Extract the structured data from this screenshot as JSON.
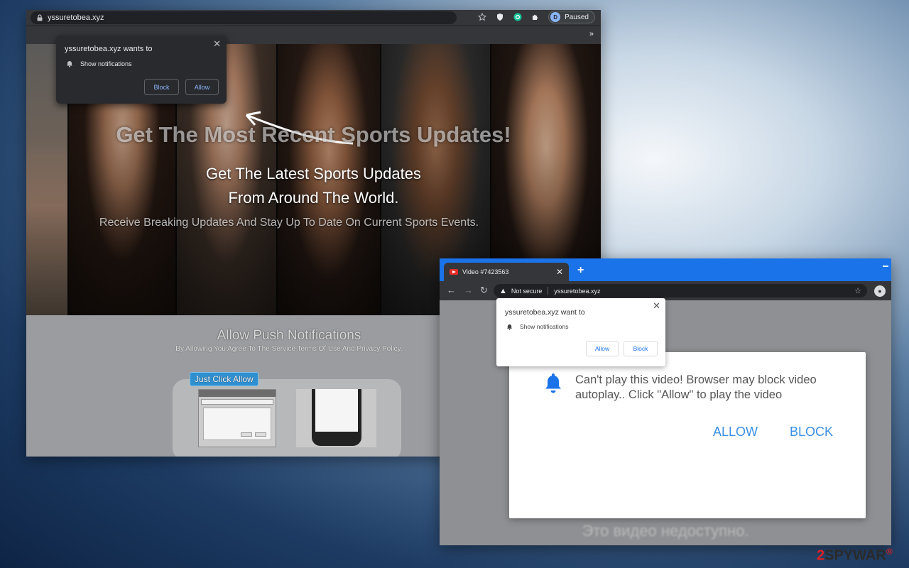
{
  "browser1": {
    "url": "yssuretobea.xyz",
    "profile": {
      "initial": "D",
      "label": "Paused"
    },
    "bookmarks_more": "»",
    "notification": {
      "title": "yssuretobea.xyz wants to",
      "item": "Show notifications",
      "block": "Block",
      "allow": "Allow",
      "close": "✕"
    },
    "hero": {
      "headline": "Get The Most Recent Sports Updates!",
      "subline1": "Get The Latest Sports Updates",
      "subline2": "From Around The World.",
      "body": "Receive Breaking Updates And Stay Up To Date On Current Sports Events."
    },
    "lower": {
      "title": "Allow Push Notifications",
      "subtitle": "By Allowing You Agree To The Service Terms Of Use And Privacy Policy.",
      "button": "Just Click Allow"
    }
  },
  "browser2": {
    "tab_title": "Video #7423563",
    "tab_close": "✕",
    "new_tab": "+",
    "not_secure": "Not secure",
    "url": "yssuretobea.xyz",
    "notification": {
      "title": "yssuretobea.xyz want to",
      "item": "Show notifications",
      "allow": "Allow",
      "block": "Block",
      "close": "✕"
    },
    "dialog": {
      "message": "Can't play this video! Browser may block video autoplay.. Click \"Allow\" to play the video",
      "allow": "ALLOW",
      "block": "BLOCK"
    },
    "unavailable": "Это видео недоступно."
  },
  "watermark": {
    "two": "2",
    "brand": "SPYWAR",
    "mark": "®"
  },
  "icons": [
    "lock-icon",
    "star-icon",
    "shield-icon",
    "grammarly-icon",
    "puzzle-icon",
    "bell-icon",
    "back-icon",
    "forward-icon",
    "reload-icon",
    "warning-icon",
    "youtube-icon"
  ],
  "colors": {
    "chrome_dark": "#35363a",
    "chrome_blue": "#1a73e8",
    "link_blue": "#3b8fe6",
    "watermark_red": "#dd2222"
  }
}
